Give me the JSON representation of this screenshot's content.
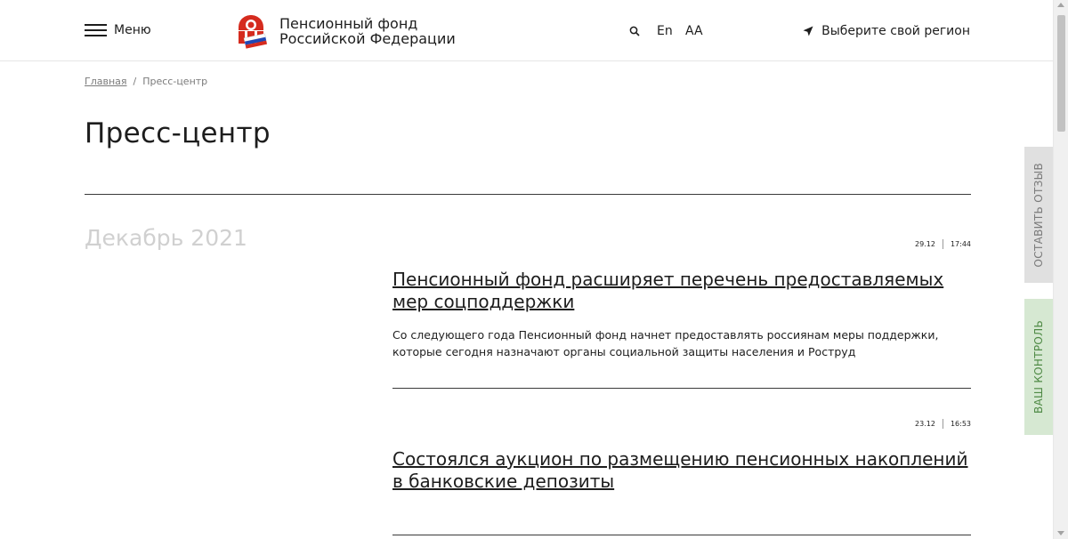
{
  "header": {
    "menu_label": "Меню",
    "logo_line1": "Пенсионный фонд",
    "logo_line2": "Российской Федерации",
    "lang_label": "En",
    "font_size_label": "AA",
    "region_label": "Выберите свой регион",
    "icons": [
      "burger-menu-icon",
      "pfr-logo-icon",
      "search-icon",
      "location-arrow-icon"
    ]
  },
  "breadcrumb": {
    "home": "Главная",
    "separator": "/",
    "current": "Пресс-центр"
  },
  "page_title": "Пресс-центр",
  "month": "Декабрь 2021",
  "side_tabs": {
    "feedback": "ОСТАВИТЬ ОТЗЫВ",
    "control": "ВАШ КОНТРОЛЬ"
  },
  "news": [
    {
      "date": "29.12",
      "time": "17:44",
      "title_line1": "Пенсионный фонд расширяет перечень предоставляемых",
      "title_line2": "мер соцподдержки",
      "desc_line1": "Со следующего года Пенсионный фонд начнет предоставлять россиянам меры поддержки,",
      "desc_line2": "которые сегодня назначают органы социальной защиты населения и Роструд"
    },
    {
      "date": "23.12",
      "time": "16:53",
      "title_line1": "Состоялся аукцион по размещению пенсионных накоплений",
      "title_line2": "в банковские депозиты"
    }
  ],
  "colors": {
    "text": "#1d1d1d",
    "muted": "#7a7a7a",
    "month": "#d0d0d0",
    "feedback_tab_bg": "#e0e0e0",
    "control_tab_bg": "#d6e8d2",
    "control_tab_text": "#4f8a45"
  }
}
